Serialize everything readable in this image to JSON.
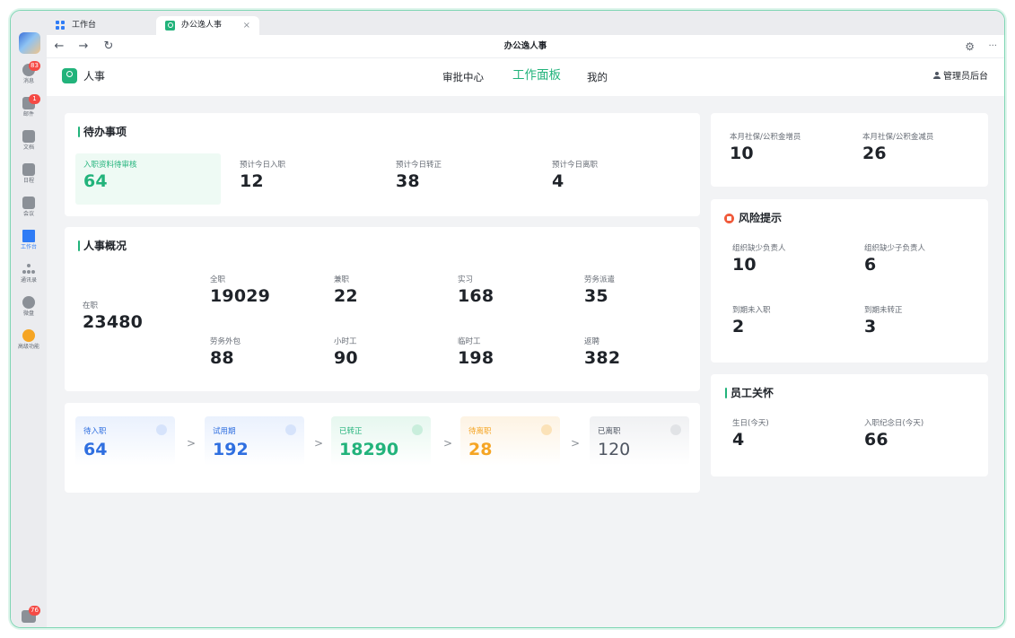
{
  "rail": {
    "items": [
      {
        "label": "消息",
        "badge": "83"
      },
      {
        "label": "邮件",
        "badge": "1"
      },
      {
        "label": "文档"
      },
      {
        "label": "日程"
      },
      {
        "label": "会议"
      },
      {
        "label": "工作台"
      },
      {
        "label": "通讯录"
      },
      {
        "label": "微盘"
      },
      {
        "label": "高级功能"
      }
    ],
    "bottom_badge": "76"
  },
  "tabs": [
    {
      "label": "工作台"
    },
    {
      "label": "办公逸人事",
      "close": "×"
    }
  ],
  "navbar": {
    "title": "办公逸人事",
    "back": "←",
    "forward": "→",
    "reload": "↻",
    "settings": "⚙",
    "more": "···"
  },
  "app": {
    "name": "人事",
    "menu": [
      "审批中心",
      "工作面板",
      "我的"
    ],
    "active_menu": "工作面板",
    "admin": "管理员后台",
    "accent": "#22b37b"
  },
  "todo": {
    "title": "待办事项",
    "items": [
      {
        "label": "入职资料待审核",
        "value": "64"
      },
      {
        "label": "预计今日入职",
        "value": "12"
      },
      {
        "label": "预计今日转正",
        "value": "38"
      },
      {
        "label": "预计今日离职",
        "value": "4"
      }
    ]
  },
  "overview": {
    "title": "人事概况",
    "total": {
      "label": "在职",
      "value": "23480"
    },
    "items": [
      {
        "label": "全职",
        "value": "19029"
      },
      {
        "label": "兼职",
        "value": "22"
      },
      {
        "label": "实习",
        "value": "168"
      },
      {
        "label": "劳务派遣",
        "value": "35"
      },
      {
        "label": "劳务外包",
        "value": "88"
      },
      {
        "label": "小时工",
        "value": "90"
      },
      {
        "label": "临时工",
        "value": "198"
      },
      {
        "label": "返聘",
        "value": "382"
      }
    ]
  },
  "flow": {
    "arrow": ">",
    "items": [
      {
        "label": "待入职",
        "value": "64",
        "color": "#2f6fe0"
      },
      {
        "label": "试用期",
        "value": "192",
        "color": "#2f6fe0"
      },
      {
        "label": "已转正",
        "value": "18290",
        "color": "#22b37b"
      },
      {
        "label": "待离职",
        "value": "28",
        "color": "#f5a524"
      },
      {
        "label": "已离职",
        "value": "120",
        "color": "#4e5561"
      }
    ]
  },
  "social": {
    "items": [
      {
        "label": "本月社保/公积金增员",
        "value": "10"
      },
      {
        "label": "本月社保/公积金减员",
        "value": "26"
      }
    ]
  },
  "risk": {
    "title": "风险提示",
    "items": [
      {
        "label": "组织缺少负责人",
        "value": "10"
      },
      {
        "label": "组织缺少子负责人",
        "value": "6"
      },
      {
        "label": "到期未入职",
        "value": "2"
      },
      {
        "label": "到期未转正",
        "value": "3"
      }
    ]
  },
  "care": {
    "title": "员工关怀",
    "items": [
      {
        "label": "生日(今天)",
        "value": "4"
      },
      {
        "label": "入职纪念日(今天)",
        "value": "66"
      }
    ]
  }
}
